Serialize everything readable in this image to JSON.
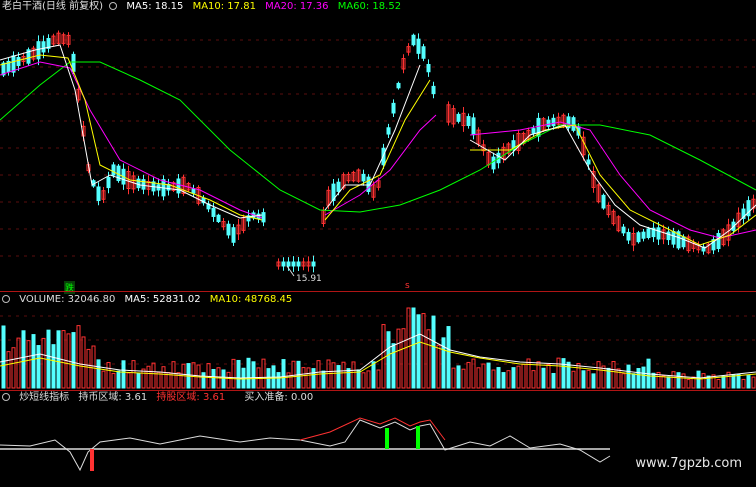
{
  "price_header": {
    "title": "老白干酒(日线 前复权)",
    "ma5": "MA5: 18.15",
    "ma10": "MA10: 17.81",
    "ma20": "MA20: 17.36",
    "ma60": "MA60: 18.52",
    "low_label": "15.91",
    "marker_left": "跌",
    "marker_mid": "s"
  },
  "volume_header": {
    "title": "VOLUME: 32046.80",
    "ma5": "MA5: 52831.02",
    "ma10": "MA10: 48768.45"
  },
  "indicator_header": {
    "title": "炒短线指标",
    "hold": "持币区域: 3.61",
    "holdshare": "持股区域: 3.61",
    "buy": "买入准备: 0.00"
  },
  "watermark": "www.7gpzb.com",
  "colors": {
    "up": "#ff3232",
    "down": "#54ffff",
    "ma5": "#ffffff",
    "ma10": "#ffff00",
    "ma20": "#ff00ff",
    "ma60": "#00ff00",
    "separator": "#b01515"
  },
  "chart_data": [
    {
      "type": "candlestick",
      "title": "老白干酒(日线 前复权)",
      "series": [
        {
          "name": "MA5",
          "values": []
        },
        {
          "name": "MA10",
          "values": []
        },
        {
          "name": "MA20",
          "values": []
        },
        {
          "name": "MA60",
          "values": []
        }
      ],
      "annotations": [
        "15.91"
      ]
    },
    {
      "type": "bar",
      "title": "VOLUME: 32046.80",
      "series": [
        {
          "name": "MA5"
        },
        {
          "name": "MA10"
        }
      ]
    },
    {
      "type": "line",
      "title": "炒短线指标",
      "series": [
        {
          "name": "持币区域"
        },
        {
          "name": "持股区域"
        },
        {
          "name": "买入准备"
        }
      ]
    }
  ]
}
